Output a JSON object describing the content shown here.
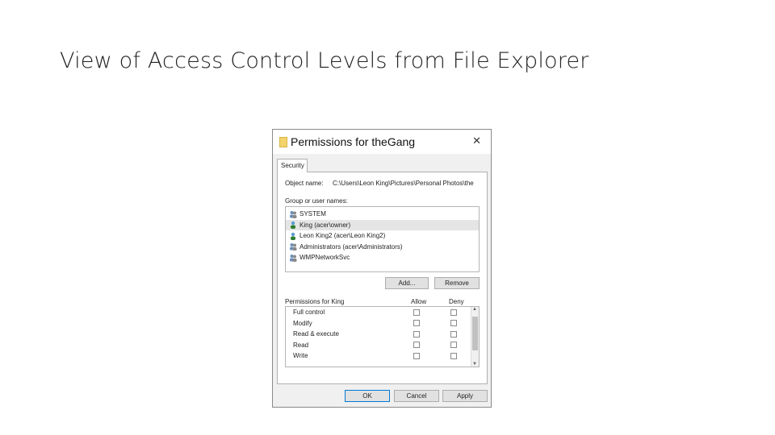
{
  "slide": {
    "title": "View of Access Control Levels from File Explorer"
  },
  "dialog": {
    "title": "Permissions for theGang",
    "close_label": "✕",
    "tab": "Security",
    "object_name_label": "Object name:",
    "object_name_value": "C:\\Users\\Leon King\\Pictures\\Personal Photos\\the",
    "groups_label": "Group or user names:",
    "users": [
      {
        "name": "SYSTEM",
        "icon": "users-group-icon"
      },
      {
        "name": "King (acer\\owner)",
        "icon": "user-icon",
        "selected": true
      },
      {
        "name": "Leon King2 (acer\\Leon King2)",
        "icon": "user-icon"
      },
      {
        "name": "Administrators (acer\\Administrators)",
        "icon": "users-group-icon"
      },
      {
        "name": "WMPNetworkSvc",
        "icon": "users-group-icon"
      }
    ],
    "add_button": "Add...",
    "remove_button": "Remove",
    "permissions_label": "Permissions for King",
    "allow_header": "Allow",
    "deny_header": "Deny",
    "permissions": [
      {
        "name": "Full control"
      },
      {
        "name": "Modify"
      },
      {
        "name": "Read & execute"
      },
      {
        "name": "Read"
      },
      {
        "name": "Write"
      }
    ],
    "ok_button": "OK",
    "cancel_button": "Cancel",
    "apply_button": "Apply",
    "colors": {
      "selection": "#e5e5e5",
      "folder": "#f3d36b",
      "button_focus": "#0078d7"
    }
  }
}
